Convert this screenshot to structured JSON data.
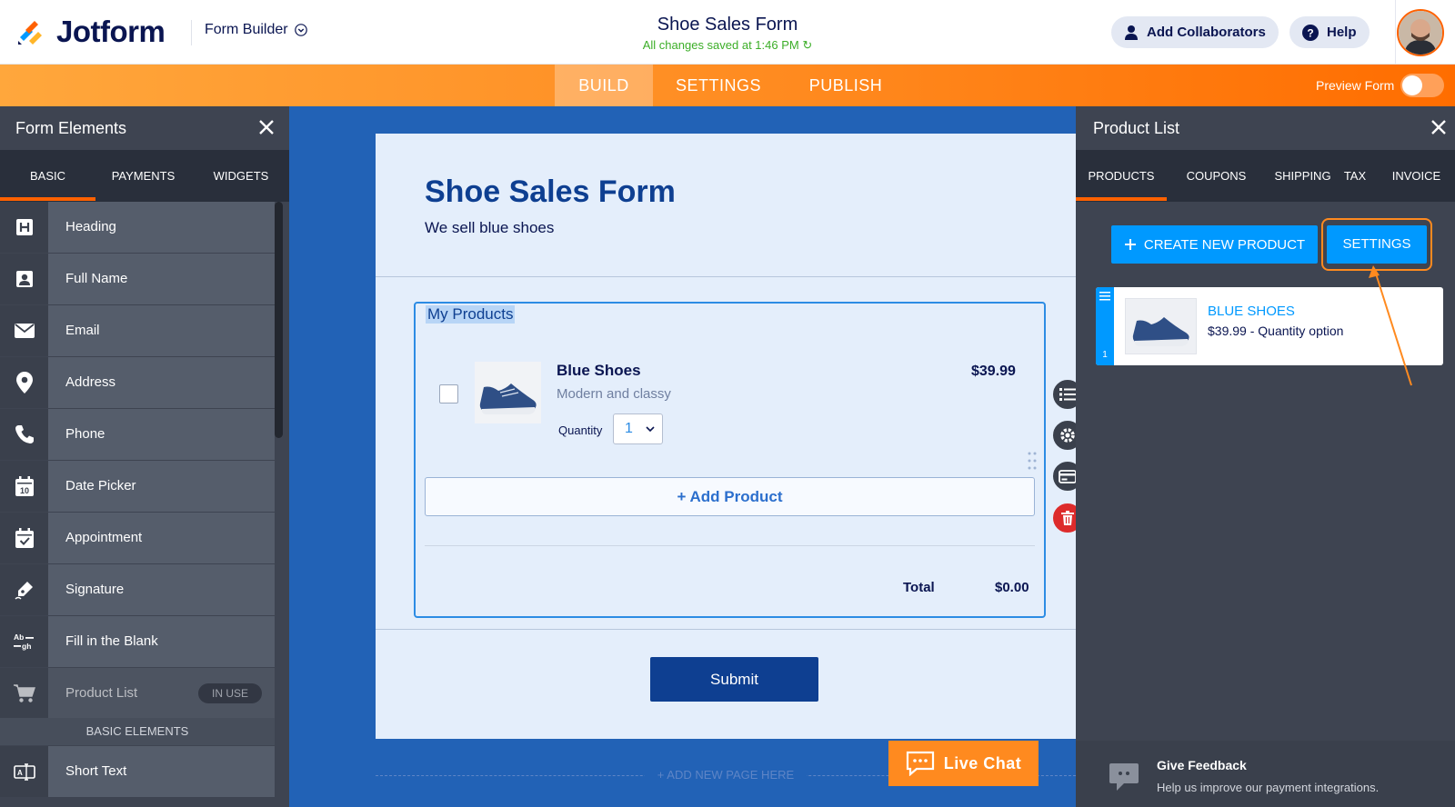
{
  "header": {
    "brand": "Jotform",
    "builder_label": "Form Builder",
    "form_title": "Shoe Sales Form",
    "saved_status": "All changes saved at 1:46 PM",
    "collaborators_label": "Add Collaborators",
    "help_label": "Help"
  },
  "nav": {
    "tabs": [
      "BUILD",
      "SETTINGS",
      "PUBLISH"
    ],
    "active_tab": "BUILD",
    "preview_label": "Preview Form",
    "preview_on": false
  },
  "left_panel": {
    "title": "Form Elements",
    "tabs": [
      "BASIC",
      "PAYMENTS",
      "WIDGETS"
    ],
    "elements": [
      {
        "label": "Heading",
        "icon": "heading-icon"
      },
      {
        "label": "Full Name",
        "icon": "person-icon"
      },
      {
        "label": "Email",
        "icon": "envelope-icon"
      },
      {
        "label": "Address",
        "icon": "map-pin-icon"
      },
      {
        "label": "Phone",
        "icon": "phone-icon"
      },
      {
        "label": "Date Picker",
        "icon": "calendar-icon"
      },
      {
        "label": "Appointment",
        "icon": "calendar-check-icon"
      },
      {
        "label": "Signature",
        "icon": "pen-icon"
      },
      {
        "label": "Fill in the Blank",
        "icon": "fill-blank-icon"
      },
      {
        "label": "Product List",
        "icon": "cart-icon",
        "badge": "IN USE"
      }
    ],
    "section_label": "BASIC ELEMENTS",
    "after_section": [
      {
        "label": "Short Text",
        "icon": "short-text-icon"
      }
    ]
  },
  "form": {
    "heading": "Shoe Sales Form",
    "subheading": "We sell blue shoes",
    "product_field_label": "My Products",
    "product": {
      "name": "Blue Shoes",
      "description": "Modern and classy",
      "price": "$39.99",
      "quantity_label": "Quantity",
      "quantity_value": "1"
    },
    "add_product_label": "+ Add Product",
    "total_label": "Total",
    "total_value": "$0.00",
    "submit_label": "Submit",
    "add_page_label": "+ ADD NEW PAGE HERE"
  },
  "live_chat_label": "Live Chat",
  "right_panel": {
    "title": "Product List",
    "tabs": [
      "PRODUCTS",
      "COUPONS",
      "SHIPPING",
      "TAX",
      "INVOICE"
    ],
    "create_label": "CREATE NEW PRODUCT",
    "settings_label": "SETTINGS",
    "product_card": {
      "number": "1",
      "name": "BLUE SHOES",
      "detail": "$39.99 - Quantity option"
    },
    "feedback_title": "Give Feedback",
    "feedback_text": "Help us improve our payment integrations."
  },
  "colors": {
    "brand_orange": "#ff6100",
    "navy": "#0a1551",
    "accent_blue": "#0099ff",
    "canvas_blue": "#2262b6",
    "saved_green": "#3cae28"
  }
}
